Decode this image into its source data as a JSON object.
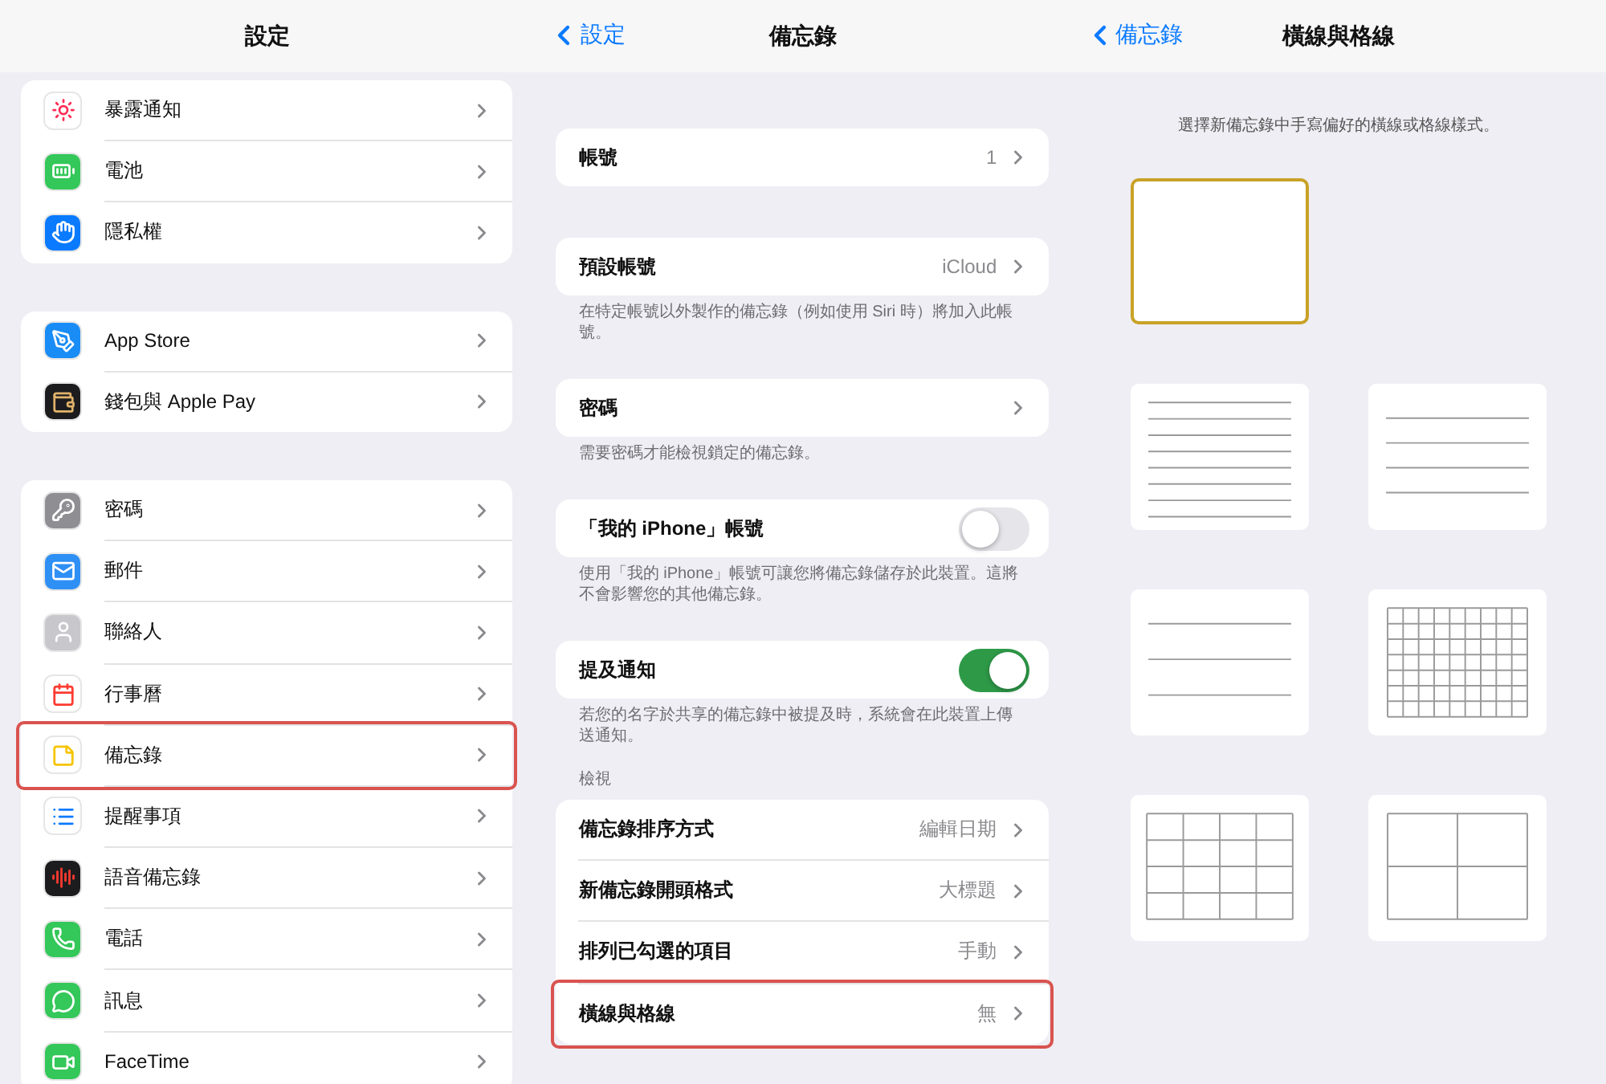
{
  "panels": [
    {
      "kind": "settings",
      "nav": {
        "title": "設定"
      },
      "groups": [
        {
          "rows": [
            {
              "label": "暴露通知",
              "kind": "exposure",
              "color": "#ffffff",
              "highlighted": false
            },
            {
              "label": "電池",
              "kind": "battery",
              "color": "#34c759",
              "highlighted": false
            },
            {
              "label": "隱私權",
              "kind": "privacy",
              "color": "#0a7aff",
              "highlighted": false
            }
          ]
        },
        {
          "rows": [
            {
              "label": "App Store",
              "kind": "appstore",
              "color": "#1a8cf5",
              "highlighted": false
            },
            {
              "label": "錢包與 Apple Pay",
              "kind": "wallet",
              "color": "#1c1c1e",
              "highlighted": false
            }
          ]
        },
        {
          "rows": [
            {
              "label": "密碼",
              "kind": "key",
              "color": "#8e8e93",
              "highlighted": false
            },
            {
              "label": "郵件",
              "kind": "mail",
              "color": "#2e8ff5",
              "highlighted": false
            },
            {
              "label": "聯絡人",
              "kind": "contacts",
              "color": "#c7c7cc",
              "highlighted": false
            },
            {
              "label": "行事曆",
              "kind": "calendar",
              "color": "#ffffff",
              "highlighted": false
            },
            {
              "label": "備忘錄",
              "kind": "notes",
              "color": "#ffffff",
              "highlighted": true
            },
            {
              "label": "提醒事項",
              "kind": "reminders",
              "color": "#ffffff",
              "highlighted": false
            },
            {
              "label": "語音備忘錄",
              "kind": "voice",
              "color": "#1c1c1e",
              "highlighted": false
            },
            {
              "label": "電話",
              "kind": "phone",
              "color": "#34c759",
              "highlighted": false
            },
            {
              "label": "訊息",
              "kind": "messages",
              "color": "#34c759",
              "highlighted": false
            },
            {
              "label": "FaceTime",
              "kind": "facetime",
              "color": "#34c759",
              "highlighted": false
            }
          ]
        }
      ]
    },
    {
      "kind": "notes",
      "nav": {
        "back": "設定",
        "title": "備忘錄"
      },
      "sections": [
        {
          "rows": [
            {
              "kind": "link",
              "label": "帳號",
              "value": "1",
              "highlighted": false
            }
          ]
        },
        {
          "rows": [
            {
              "kind": "link",
              "label": "預設帳號",
              "value": "iCloud",
              "highlighted": false
            }
          ],
          "footer": "在特定帳號以外製作的備忘錄（例如使用 Siri 時）將加入此帳號。"
        },
        {
          "rows": [
            {
              "kind": "link",
              "label": "密碼",
              "highlighted": false
            }
          ],
          "footer": "需要密碼才能檢視鎖定的備忘錄。"
        },
        {
          "rows": [
            {
              "kind": "toggle",
              "label": "「我的 iPhone」帳號",
              "on": false,
              "highlighted": false
            }
          ],
          "footer": "使用「我的 iPhone」帳號可讓您將備忘錄儲存於此裝置。這將不會影響您的其他備忘錄。"
        },
        {
          "rows": [
            {
              "kind": "toggle",
              "label": "提及通知",
              "on": true,
              "highlighted": false
            }
          ],
          "footer": "若您的名字於共享的備忘錄中被提及時，系統會在此裝置上傳送通知。"
        },
        {
          "header": "檢視",
          "rows": [
            {
              "kind": "link",
              "label": "備忘錄排序方式",
              "value": "編輯日期",
              "highlighted": false
            },
            {
              "kind": "link",
              "label": "新備忘錄開頭格式",
              "value": "大標題",
              "highlighted": false
            },
            {
              "kind": "link",
              "label": "排列已勾選的項目",
              "value": "手動",
              "highlighted": false
            },
            {
              "kind": "link",
              "label": "橫線與格線",
              "value": "無",
              "highlighted": true
            }
          ]
        }
      ]
    },
    {
      "kind": "lines",
      "nav": {
        "back": "備忘錄",
        "title": "橫線與格線"
      },
      "description": "選擇新備忘錄中手寫偏好的橫線或格線樣式。",
      "style_rows": [
        {
          "styles": [
            {
              "kind": "blank",
              "selected": true
            }
          ]
        },
        {
          "styles": [
            {
              "kind": "lines-small",
              "selected": false
            },
            {
              "kind": "lines-medium",
              "selected": false
            }
          ]
        },
        {
          "styles": [
            {
              "kind": "lines-large",
              "selected": false
            },
            {
              "kind": "grid-small",
              "selected": false
            }
          ]
        },
        {
          "styles": [
            {
              "kind": "grid-medium",
              "selected": false
            },
            {
              "kind": "grid-large",
              "selected": false
            }
          ]
        }
      ]
    }
  ]
}
